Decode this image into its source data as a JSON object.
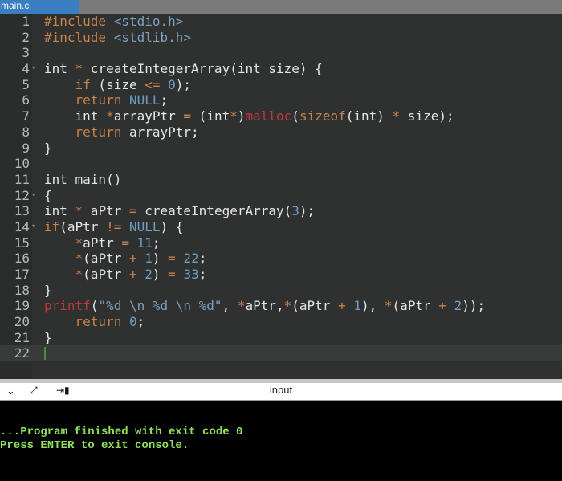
{
  "tab": {
    "title": "main.c"
  },
  "editor": {
    "lines": [
      {
        "n": "1",
        "text": "#include <stdio.h>"
      },
      {
        "n": "2",
        "text": "#include <stdlib.h>"
      },
      {
        "n": "3",
        "text": ""
      },
      {
        "n": "4",
        "text": "int * createIntegerArray(int size) {",
        "fold": true
      },
      {
        "n": "5",
        "text": "    if (size <= 0);"
      },
      {
        "n": "6",
        "text": "    return NULL;"
      },
      {
        "n": "7",
        "text": "    int *arrayPtr = (int*)malloc(sizeof(int) * size);"
      },
      {
        "n": "8",
        "text": "    return arrayPtr;"
      },
      {
        "n": "9",
        "text": "}"
      },
      {
        "n": "10",
        "text": ""
      },
      {
        "n": "11",
        "text": "int main()"
      },
      {
        "n": "12",
        "text": "{",
        "fold": true
      },
      {
        "n": "13",
        "text": "int * aPtr = createIntegerArray(3);"
      },
      {
        "n": "14",
        "text": "if(aPtr != NULL) {",
        "fold": true
      },
      {
        "n": "15",
        "text": "    *aPtr = 11;"
      },
      {
        "n": "16",
        "text": "    *(aPtr + 1) = 22;"
      },
      {
        "n": "17",
        "text": "    *(aPtr + 2) = 33;"
      },
      {
        "n": "18",
        "text": "}"
      },
      {
        "n": "19",
        "text": "printf(\"%d \\n %d \\n %d\", *aPtr,*(aPtr + 1), *(aPtr + 2));"
      },
      {
        "n": "20",
        "text": "    return 0;"
      },
      {
        "n": "21",
        "text": "}"
      },
      {
        "n": "22",
        "text": "",
        "active": true
      }
    ]
  },
  "console_bar": {
    "title": "input",
    "icons": [
      "chevron-down-icon",
      "expand-icon",
      "input-toggle-icon"
    ]
  },
  "console": {
    "lines": [
      "...Program finished with exit code 0",
      "Press ENTER to exit console."
    ]
  },
  "colors": {
    "tab_active": "#3a7fc1",
    "editor_bg": "#2f3030",
    "keyword": "#c8834b",
    "number": "#6d9cc6",
    "builtin_fn": "#c0393b",
    "console_text": "#8fe05a"
  }
}
